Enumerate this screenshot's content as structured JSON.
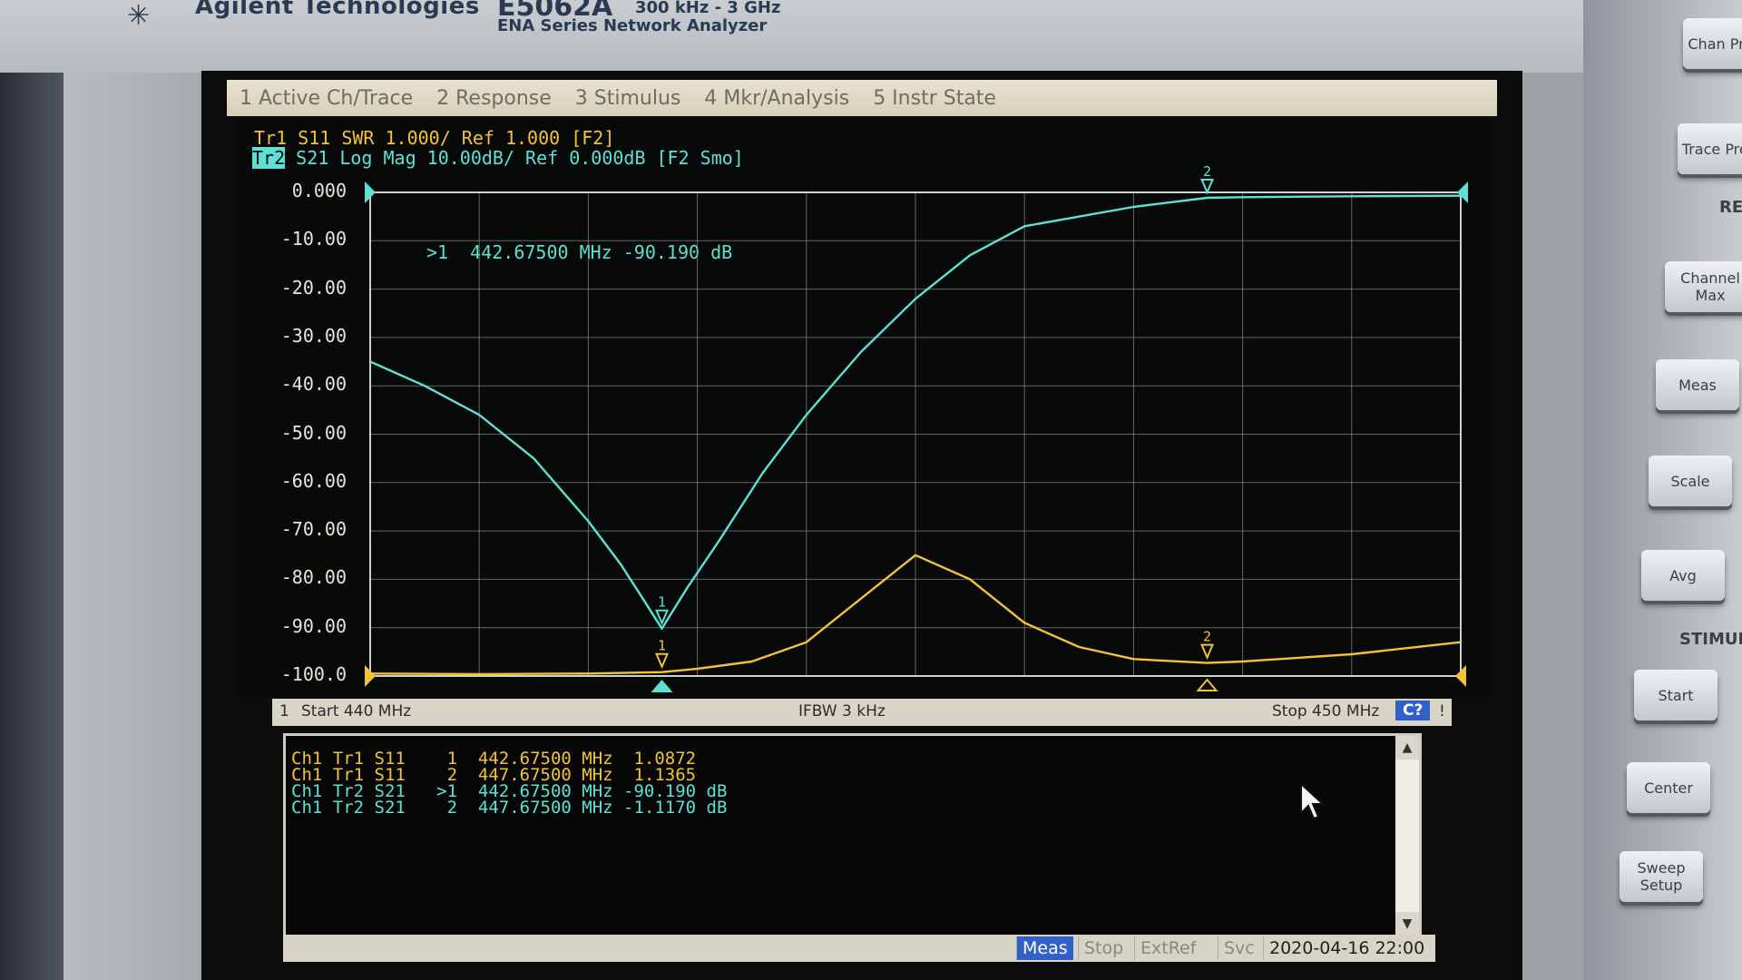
{
  "instrument": {
    "brand": "Agilent Technologies",
    "model": "E5062A",
    "freq_range": "300 kHz - 3 GHz",
    "series": "ENA Series Network Analyzer"
  },
  "menu": [
    "1 Active Ch/Trace",
    "2 Response",
    "3 Stimulus",
    "4 Mkr/Analysis",
    "5 Instr State"
  ],
  "header": {
    "trace1": "Tr1 S11 SWR 1.000/ Ref 1.000 [F2]",
    "trace2_tag": "Tr2",
    "trace2_rest": " S21 Log Mag 10.00dB/ Ref 0.000dB [F2 Smo]"
  },
  "y_labels": [
    "0.000",
    "-10.00",
    "-20.00",
    "-30.00",
    "-40.00",
    "-50.00",
    "-60.00",
    "-70.00",
    "-80.00",
    "-90.00",
    "-100.0"
  ],
  "marker_readout": ">1  442.67500 MHz -90.190 dB",
  "status": {
    "channel": "1",
    "start": "Start 440 MHz",
    "ifbw": "IFBW 3 kHz",
    "stop": "Stop 450 MHz",
    "cal": "C?",
    "alert": "!"
  },
  "marker_table": [
    {
      "text": "Ch1 Tr1 S11    1  442.67500 MHz  1.0872",
      "color": "#f2c23a"
    },
    {
      "text": "Ch1 Tr1 S11    2  447.67500 MHz  1.1365",
      "color": "#f2c23a"
    },
    {
      "text": "Ch1 Tr2 S21   >1  442.67500 MHz -90.190 dB",
      "color": "#5fe0d4"
    },
    {
      "text": "Ch1 Tr2 S21    2  447.67500 MHz -1.1170 dB",
      "color": "#5fe0d4"
    }
  ],
  "bottom_bar": {
    "meas": "Meas",
    "stop": "Stop",
    "extref": "ExtRef",
    "svc": "Svc",
    "datetime": "2020-04-16 22:00"
  },
  "softkeys": {
    "chan_prev": "Chan Prev",
    "trace_prev": "Trace Prev",
    "channel_max": "Channel Max",
    "meas": "Meas",
    "scale": "Scale",
    "avg": "Avg",
    "start": "Start",
    "center": "Center",
    "sweep_setup": "Sweep Setup"
  },
  "panel_labels": {
    "response": "RE",
    "stimulus": "STIMUL"
  },
  "colors": {
    "trace_s11": "#f2c23a",
    "trace_s21": "#5fe0d4",
    "grid": "#8a8d86",
    "background": "#080909"
  },
  "chart_data": {
    "type": "line",
    "x_unit": "MHz",
    "xlim": [
      440,
      450
    ],
    "series": [
      {
        "name": "S21",
        "axis_ylim": [
          -100,
          0
        ],
        "x": [
          440,
          440.5,
          441,
          441.5,
          442,
          442.3,
          442.5,
          442.675,
          442.9,
          443.2,
          443.6,
          444,
          444.5,
          445,
          445.5,
          446,
          447,
          447.675,
          448,
          449,
          450
        ],
        "y": [
          -35,
          -40,
          -46,
          -55,
          -68,
          -77,
          -84,
          -90.19,
          -82,
          -72,
          -58,
          -46,
          -33,
          -22,
          -13,
          -7,
          -3,
          -1.117,
          -1,
          -0.8,
          -0.7
        ]
      },
      {
        "name": "S11",
        "axis_ylim": [
          -100,
          0
        ],
        "x": [
          440,
          441,
          442,
          442.675,
          443,
          443.5,
          444,
          444.5,
          445,
          445.5,
          446,
          446.5,
          447,
          447.675,
          448,
          449,
          450
        ],
        "y": [
          -99.5,
          -99.6,
          -99.5,
          -99.2,
          -98.5,
          -97,
          -93,
          -84,
          -75,
          -80,
          -89,
          -94,
          -96.5,
          -97.3,
          -97,
          -95.5,
          -93
        ]
      }
    ],
    "markers": [
      {
        "label": "1",
        "x": 442.675
      },
      {
        "label": "2",
        "x": 447.675
      }
    ]
  }
}
